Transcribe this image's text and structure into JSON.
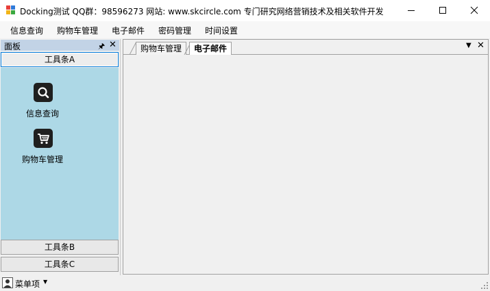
{
  "window": {
    "title": "Docking测试  QQ群：98596273  网站: www.skcircle.com  专门研究网络营销技术及相关软件开发"
  },
  "menu": [
    "信息查询",
    "购物车管理",
    "电子邮件",
    "密码管理",
    "时间设置"
  ],
  "panel": {
    "title": "面板",
    "toolbars": [
      "工具条A",
      "工具条B",
      "工具条C"
    ],
    "items": [
      {
        "label": "信息查询",
        "icon": "search-icon"
      },
      {
        "label": "购物车管理",
        "icon": "cart-icon"
      }
    ],
    "content_bg": "#add8e6"
  },
  "tabs": [
    {
      "label": "购物车管理",
      "active": false
    },
    {
      "label": "电子邮件",
      "active": true
    }
  ],
  "status": {
    "label": "菜单项"
  }
}
